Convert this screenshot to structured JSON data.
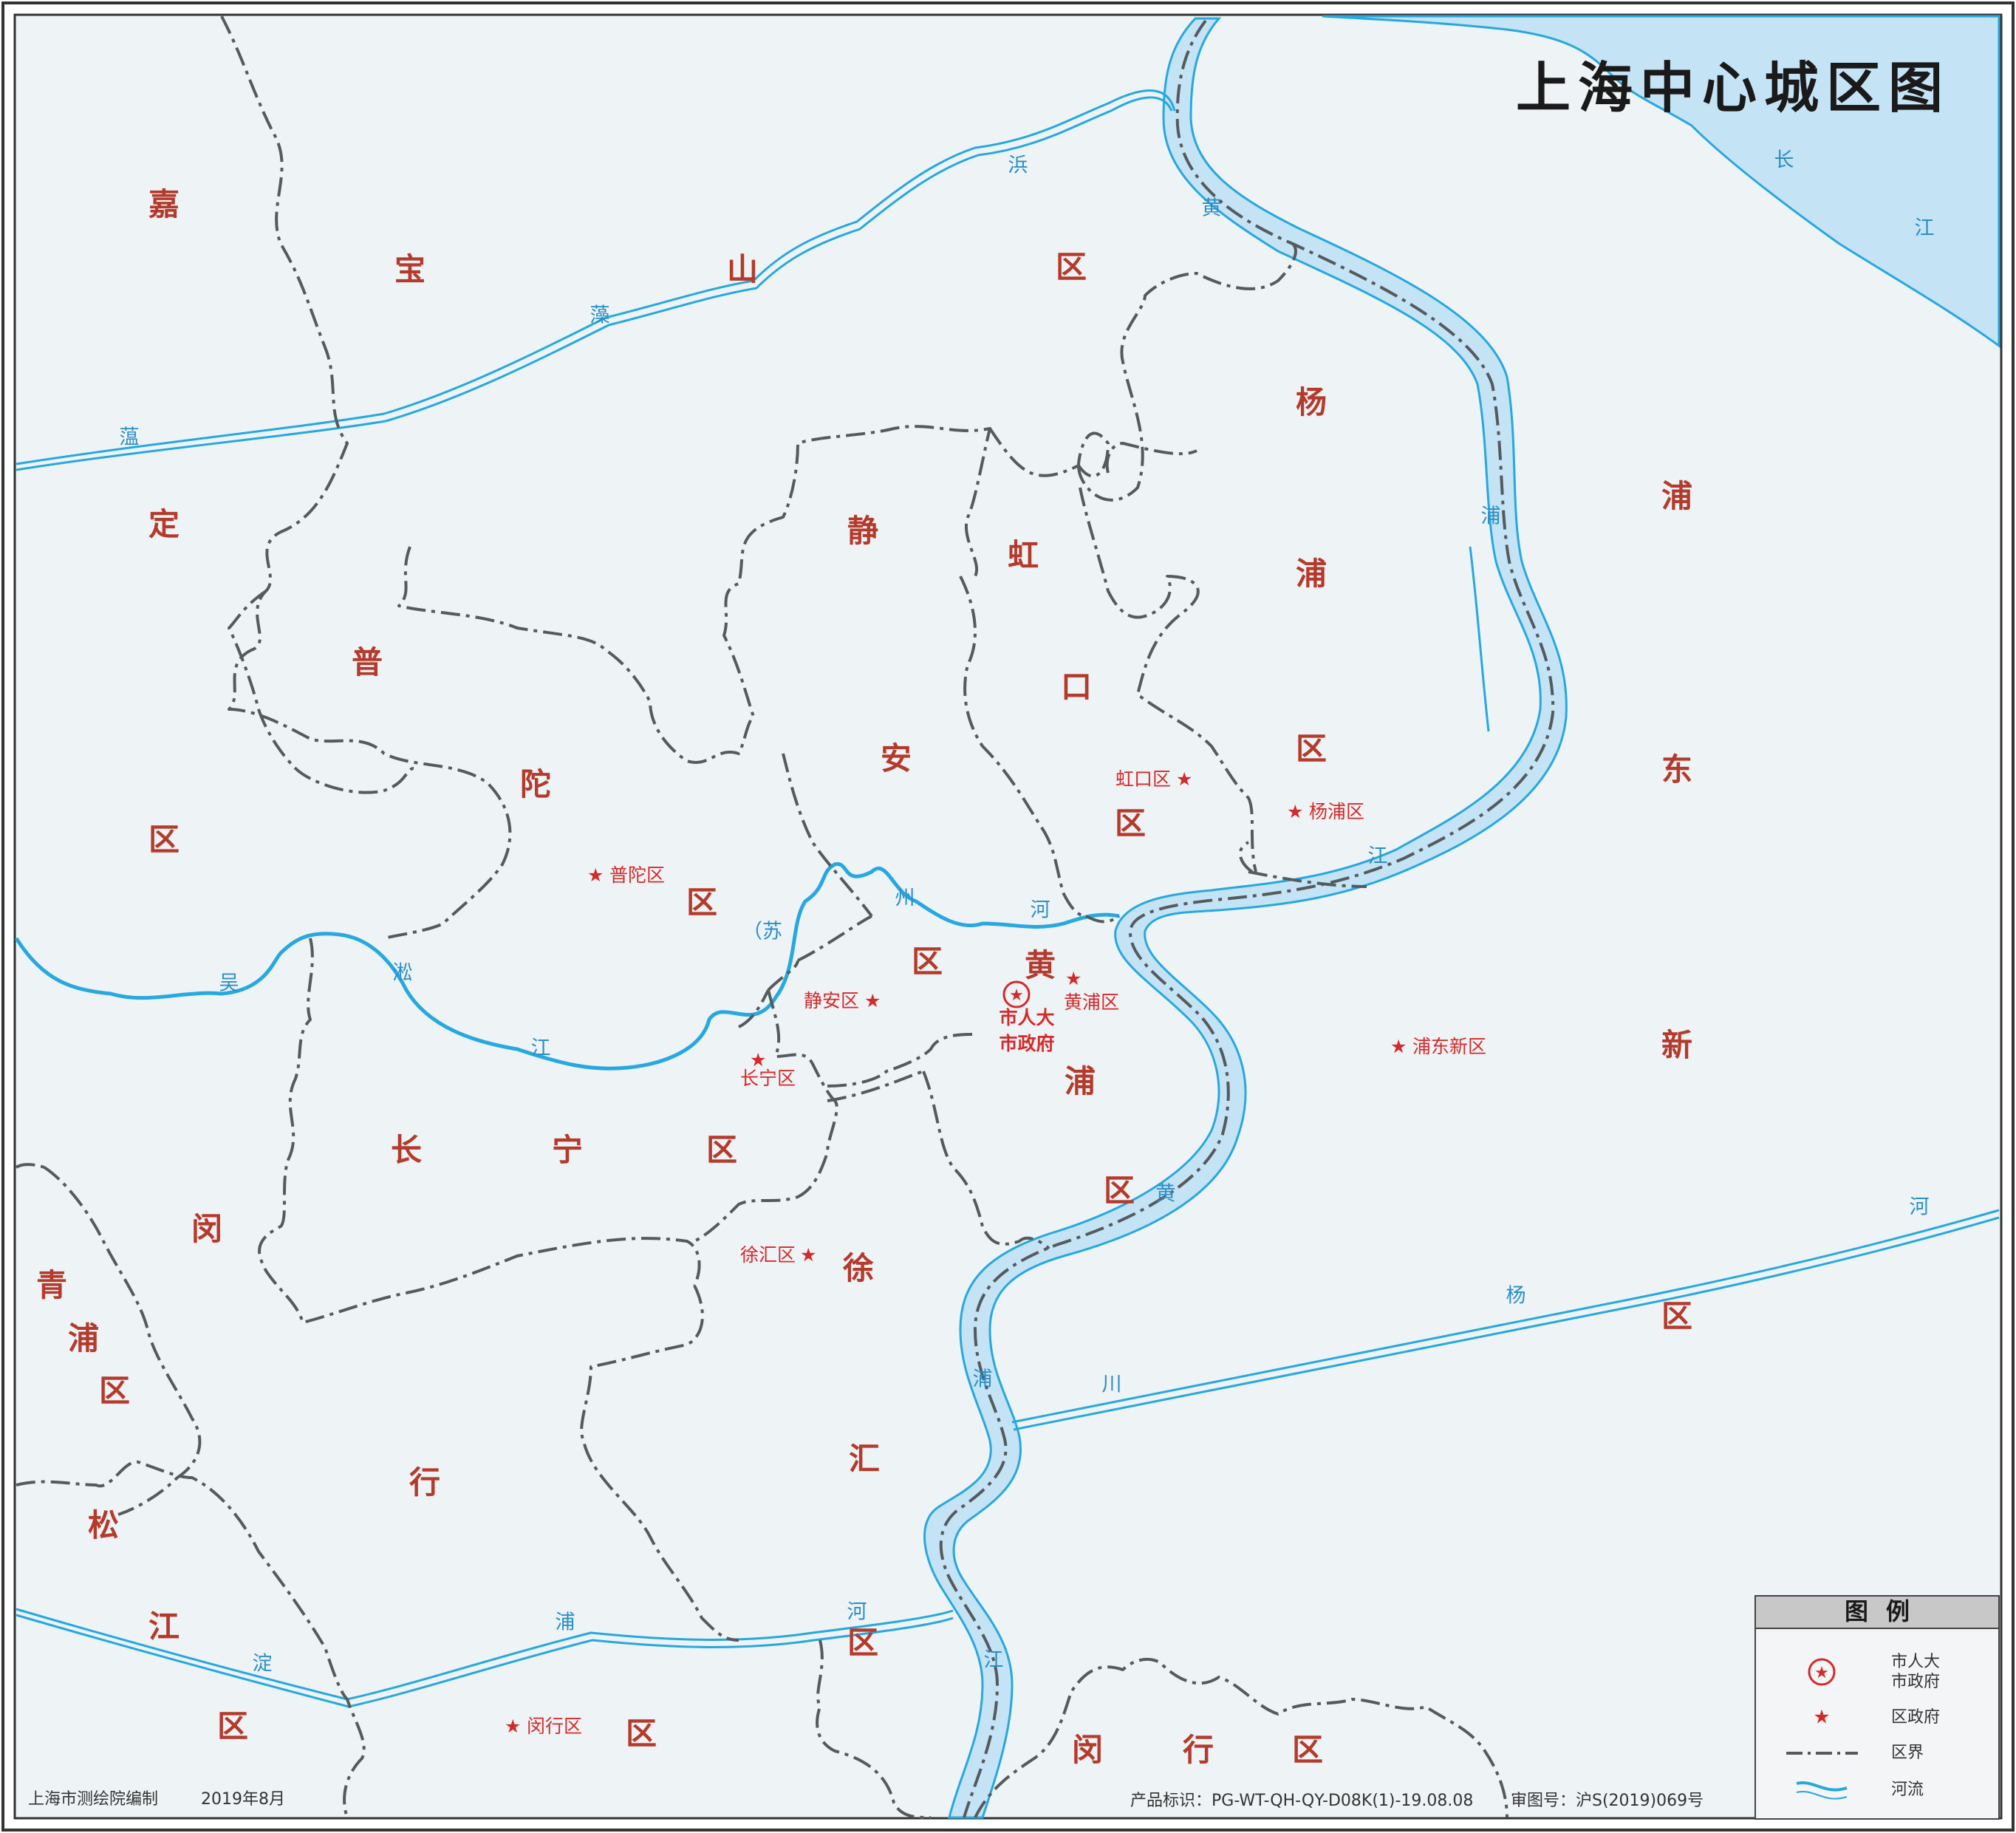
{
  "title": "上海中心城区图",
  "districts": {
    "baoshan": [
      "宝",
      "山",
      "区"
    ],
    "jiading": [
      "嘉",
      "定",
      "区"
    ],
    "putuo": [
      "普",
      "陀",
      "区"
    ],
    "jingan": [
      "静",
      "安",
      "区"
    ],
    "hongkou": [
      "虹",
      "口",
      "区"
    ],
    "yangpu": [
      "杨",
      "浦",
      "区"
    ],
    "pudong": [
      "浦",
      "东",
      "新",
      "区"
    ],
    "changning": [
      "长",
      "宁",
      "区"
    ],
    "huangpu": [
      "黄",
      "浦",
      "区"
    ],
    "xuhui": [
      "徐",
      "汇",
      "区"
    ],
    "minhang_w": [
      "闵",
      "行",
      "区"
    ],
    "minhang_s": [
      "闵",
      "行",
      "区"
    ],
    "qingpu": [
      "青",
      "浦",
      "区"
    ],
    "songjiang": [
      "松",
      "江",
      "区"
    ],
    "minhang_bottom_left": [
      "闵",
      "行",
      "区"
    ]
  },
  "rivers": {
    "yangtze": [
      "长",
      "江"
    ],
    "huangpu_upper": [
      "黄",
      "浦",
      "江"
    ],
    "huangpu_lower": [
      "黄",
      "浦",
      "江"
    ],
    "huangpu_mid": "黄",
    "wenzaobang": [
      "蕰",
      "藻",
      "浜"
    ],
    "suzhou": [
      "（苏",
      "州",
      "河"
    ],
    "wusong": [
      "吴",
      "淞",
      "江"
    ],
    "chuanyang": [
      "川",
      "杨",
      "河"
    ],
    "dianpu": [
      "淀",
      "浦",
      "河"
    ]
  },
  "gov_seats": {
    "putuo": "普陀区",
    "hongkou": "虹口区",
    "yangpu": "杨浦区",
    "jingan": "静安区",
    "huangpu": "黄浦区",
    "changning": "长宁区",
    "pudong": "浦东新区",
    "xuhui": "徐汇区",
    "minhang": "闵行区"
  },
  "city_gov": [
    "市人大",
    "市政府"
  ],
  "legend": {
    "title": "图例",
    "items": [
      {
        "icon": "city-government-icon",
        "label": [
          "市人大",
          "市政府"
        ]
      },
      {
        "icon": "district-government-star-icon",
        "label": [
          "区政府"
        ]
      },
      {
        "icon": "district-boundary-line-icon",
        "label": [
          "区界"
        ]
      },
      {
        "icon": "river-icon",
        "label": [
          "河流"
        ]
      }
    ]
  },
  "footer": {
    "publisher": "上海市测绘院编制",
    "date": "2019年8月",
    "product_id": "产品标识：PG-WT-QH-QY-D08K(1)-19.08.08",
    "review_no": "审图号：沪S(2019)069号"
  },
  "colors": {
    "land": "#eef3f6",
    "water": "#c4e3f5",
    "river_stroke": "#27a8de",
    "boundary": "#555a5e",
    "district_label": "#b43a2c",
    "gov_marker": "#d42a2a"
  }
}
